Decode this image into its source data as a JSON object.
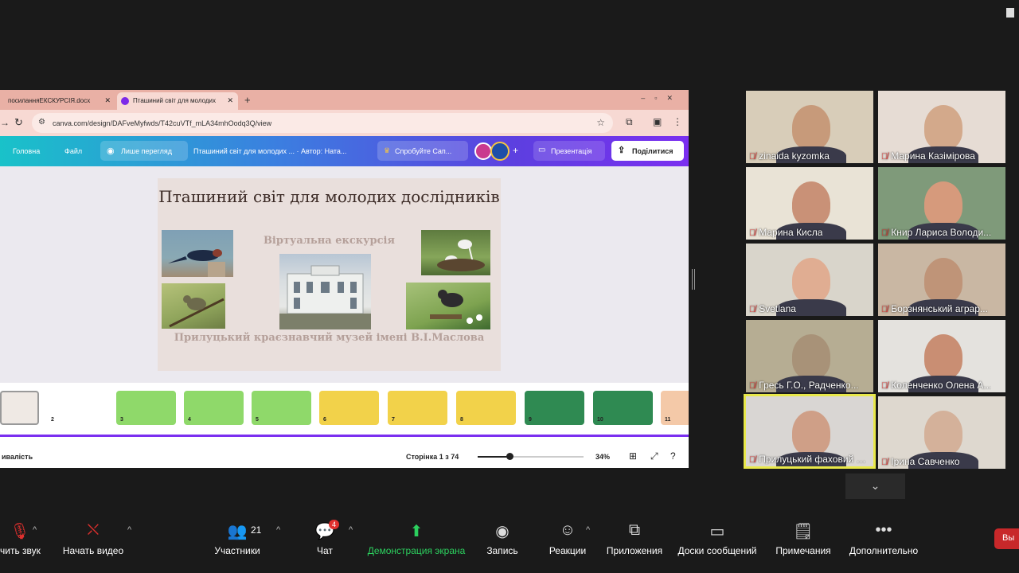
{
  "browser": {
    "tabs": [
      {
        "label": "посиланняЕКСКУРСІЯ.docx"
      },
      {
        "label": "Пташиний світ для молодих"
      }
    ],
    "url": "canva.com/design/DAFveMyfwds/T42cuVTf_mLA34mhOodq3Q/view"
  },
  "canva": {
    "home": "Головна",
    "file": "Файл",
    "view_only": "Лише перегляд",
    "doc_title": "Пташиний світ для молодих ... · Автор: Ната...",
    "try": "Спробуйте Cап...",
    "present": "Презентація",
    "share": "Поділитися"
  },
  "slide": {
    "title": "Пташиний світ для молодих дослідників",
    "subtitle": "Віртуальна екскурсія",
    "museum": "Прилуцький краєзнавчий музей імені В.І.Маслова"
  },
  "thumbnails": [
    {
      "num": "",
      "color": "#efe9e4"
    },
    {
      "num": "2",
      "color": "#ffffff"
    },
    {
      "num": "3",
      "color": "#8fd96a"
    },
    {
      "num": "4",
      "color": "#8fd96a"
    },
    {
      "num": "5",
      "color": "#8fd96a"
    },
    {
      "num": "6",
      "color": "#f2d24a"
    },
    {
      "num": "7",
      "color": "#f2d24a"
    },
    {
      "num": "8",
      "color": "#f2d24a"
    },
    {
      "num": "9",
      "color": "#2f8a52"
    },
    {
      "num": "10",
      "color": "#2f8a52"
    },
    {
      "num": "11",
      "color": "#f4c9a8"
    }
  ],
  "statusbar": {
    "left": "ивалість",
    "page": "Сторінка 1 з 74",
    "zoom_level": 0.3,
    "zoom": "34%"
  },
  "participants": [
    {
      "name": "zinaida kyzomka",
      "bg": "#d8cdb9",
      "skin": "#c79a7a"
    },
    {
      "name": "Марина Казімірова",
      "bg": "#e6dcd4",
      "skin": "#d3a98b"
    },
    {
      "name": "Марина Кисла",
      "bg": "#e9e3d6",
      "skin": "#c99177"
    },
    {
      "name": "Книр Лариса Володи...",
      "bg": "#7f9a7a",
      "skin": "#d69a7c"
    },
    {
      "name": "Svetlana",
      "bg": "#d9d5cb",
      "skin": "#e0ad92"
    },
    {
      "name": "Борзнянський аграр...",
      "bg": "#c9b7a3",
      "skin": "#bf9478"
    },
    {
      "name": "Гресь Г.О., Радченко...",
      "bg": "#b6ad93",
      "skin": "#a89278"
    },
    {
      "name": "Коленченко Олена А...",
      "bg": "#e4e2de",
      "skin": "#c98e73"
    },
    {
      "name": "Прилуцький фаховий м...",
      "bg": "#d9d6d3",
      "skin": "#cf9f87"
    },
    {
      "name": "Ірина Савченко",
      "bg": "#ded8cf",
      "skin": "#d4b19a"
    }
  ],
  "toolbar": {
    "audio": "чить звук",
    "video": "Начать видео",
    "participants": "Участники",
    "participants_count": "21",
    "chat": "Чат",
    "chat_badge": "4",
    "share_screen": "Демонстрация экрана",
    "record": "Запись",
    "reactions": "Реакции",
    "apps": "Приложения",
    "whiteboards": "Доски сообщений",
    "notes": "Примечания",
    "more": "Дополнительно",
    "exit": "Вы"
  },
  "colors": {
    "accent": "#7b2ff0",
    "share_green": "#2ccf5e",
    "mute_red": "#e0302e",
    "active_speaker": "#e8e84a"
  }
}
